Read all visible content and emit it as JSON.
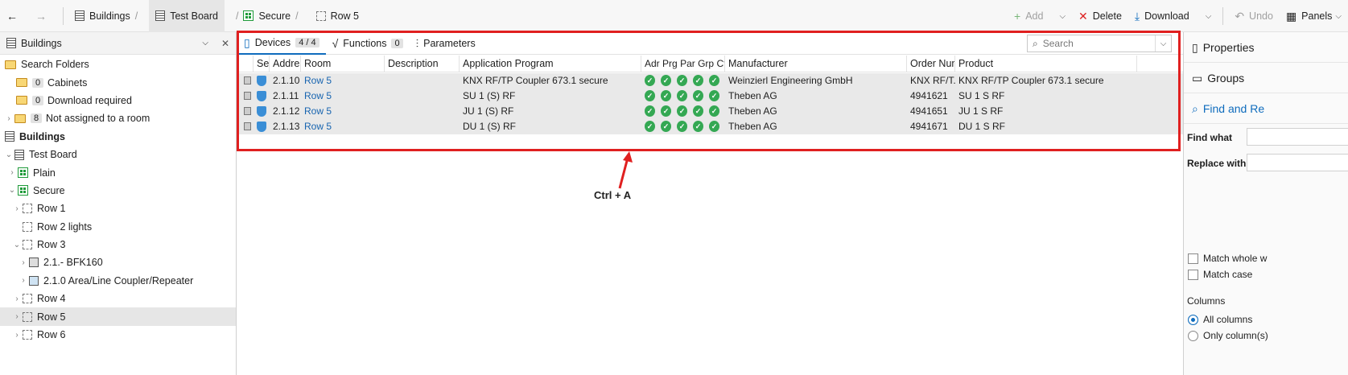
{
  "toolbar": {
    "breadcrumbs": [
      "Buildings",
      "Test Board",
      "Secure",
      "Row 5"
    ],
    "add_label": "Add",
    "delete_label": "Delete",
    "download_label": "Download",
    "undo_label": "Undo",
    "panels_label": "Panels"
  },
  "left_panel": {
    "title": "Buildings",
    "tree": {
      "search_folders": "Search Folders",
      "cabinets": {
        "count": "0",
        "label": "Cabinets"
      },
      "download_required": {
        "count": "0",
        "label": "Download required"
      },
      "not_assigned": {
        "count": "8",
        "label": "Not assigned to a room"
      },
      "buildings": "Buildings",
      "test_board": "Test Board",
      "plain": "Plain",
      "secure": "Secure",
      "row1": "Row 1",
      "row2": "Row 2 lights",
      "row3": "Row 3",
      "bfk": "2.1.- BFK160",
      "coupler": "2.1.0 Area/Line Coupler/Repeater",
      "row4": "Row 4",
      "row5": "Row 5",
      "row6": "Row 6"
    }
  },
  "main": {
    "tabs": {
      "devices": "Devices",
      "devices_count": "4 / 4",
      "functions": "Functions",
      "functions_count": "0",
      "parameters": "Parameters"
    },
    "search_placeholder": "Search",
    "columns": {
      "se": "Se",
      "address": "Addres",
      "room": "Room",
      "description": "Description",
      "app_program": "Application Program",
      "adr": "Adr",
      "prg": "Prg",
      "par": "Par",
      "grp": "Grp",
      "cfg": "Cfg",
      "manufacturer": "Manufacturer",
      "order_num": "Order Num",
      "product": "Product"
    },
    "rows": [
      {
        "address": "2.1.10",
        "room": "Row 5",
        "app": "KNX RF/TP Coupler 673.1 secure",
        "manufacturer": "Weinzierl Engineering GmbH",
        "order": "KNX RF/T...",
        "product": "KNX RF/TP Coupler 673.1 secure"
      },
      {
        "address": "2.1.11",
        "room": "Row 5",
        "app": "SU 1 (S) RF",
        "manufacturer": "Theben AG",
        "order": "4941621",
        "product": "SU 1 S RF"
      },
      {
        "address": "2.1.12",
        "room": "Row 5",
        "app": "JU 1 (S) RF",
        "manufacturer": "Theben AG",
        "order": "4941651",
        "product": "JU 1 S RF"
      },
      {
        "address": "2.1.13",
        "room": "Row 5",
        "app": "DU 1 (S) RF",
        "manufacturer": "Theben AG",
        "order": "4941671",
        "product": "DU 1 S RF"
      }
    ],
    "annotation": "Ctrl + A"
  },
  "right_panel": {
    "properties": "Properties",
    "groups": "Groups",
    "find_replace": "Find and Re",
    "find_what": "Find what",
    "replace_with": "Replace with",
    "match_whole": "Match whole w",
    "match_case": "Match case",
    "columns_label": "Columns",
    "all_columns": "All columns",
    "only_columns": "Only column(s)"
  }
}
